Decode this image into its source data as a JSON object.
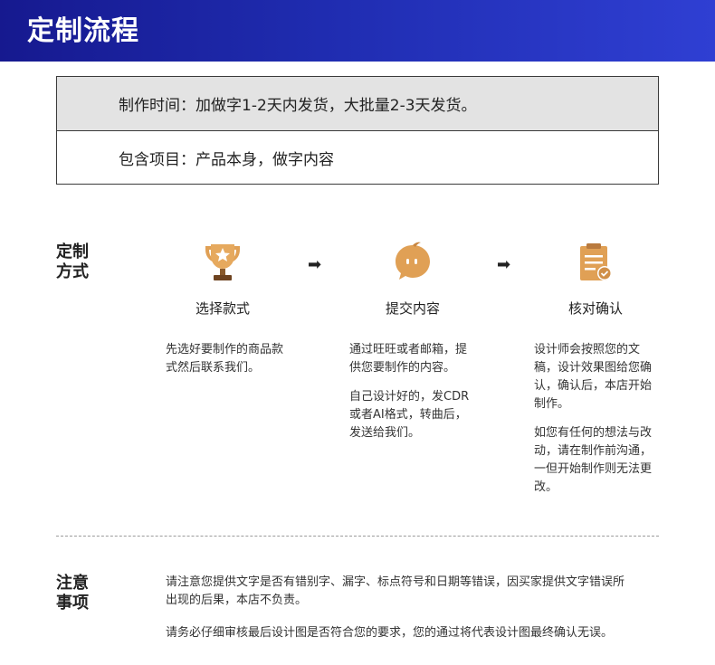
{
  "header": {
    "title": "定制流程"
  },
  "info": {
    "production_time": "制作时间：加做字1-2天内发货，大批量2-3天发货。",
    "includes": "包含项目：产品本身，做字内容"
  },
  "method": {
    "label_line1": "定制",
    "label_line2": "方式",
    "arrow": "➡",
    "steps": [
      {
        "icon": "trophy-icon",
        "title": "选择款式",
        "desc": [
          "先选好要制作的商品款",
          "式然后联系我们。"
        ]
      },
      {
        "icon": "chat-bubble-icon",
        "title": "提交内容",
        "desc1": [
          "通过旺旺或者邮箱，提",
          "供您要制作的内容。"
        ],
        "desc2": [
          "自己设计好的，发CDR",
          "或者AI格式，转曲后，",
          "发送给我们。"
        ]
      },
      {
        "icon": "clipboard-check-icon",
        "title": "核对确认",
        "desc1": [
          "设计师会按照您的文",
          "稿，设计效果图给您确",
          "认，确认后，本店开始",
          "制作。"
        ],
        "desc2": [
          "如您有任何的想法与改",
          "动，请在制作前沟通，",
          "一但开始制作则无法更",
          "改。"
        ]
      }
    ]
  },
  "notes": {
    "label_line1": "注意",
    "label_line2": "事项",
    "note1": [
      "请注意您提供文字是否有错别字、漏字、标点符号和日期等错误，因买家提供文字错误所",
      "出现的后果，本店不负责。"
    ],
    "note2": "请务必仔细审核最后设计图是否符合您的要求，您的通过将代表设计图最终确认无误。"
  },
  "colors": {
    "header": "#1f2cb0",
    "icon_gold": "#e0a055",
    "icon_dark": "#7a4a22"
  }
}
